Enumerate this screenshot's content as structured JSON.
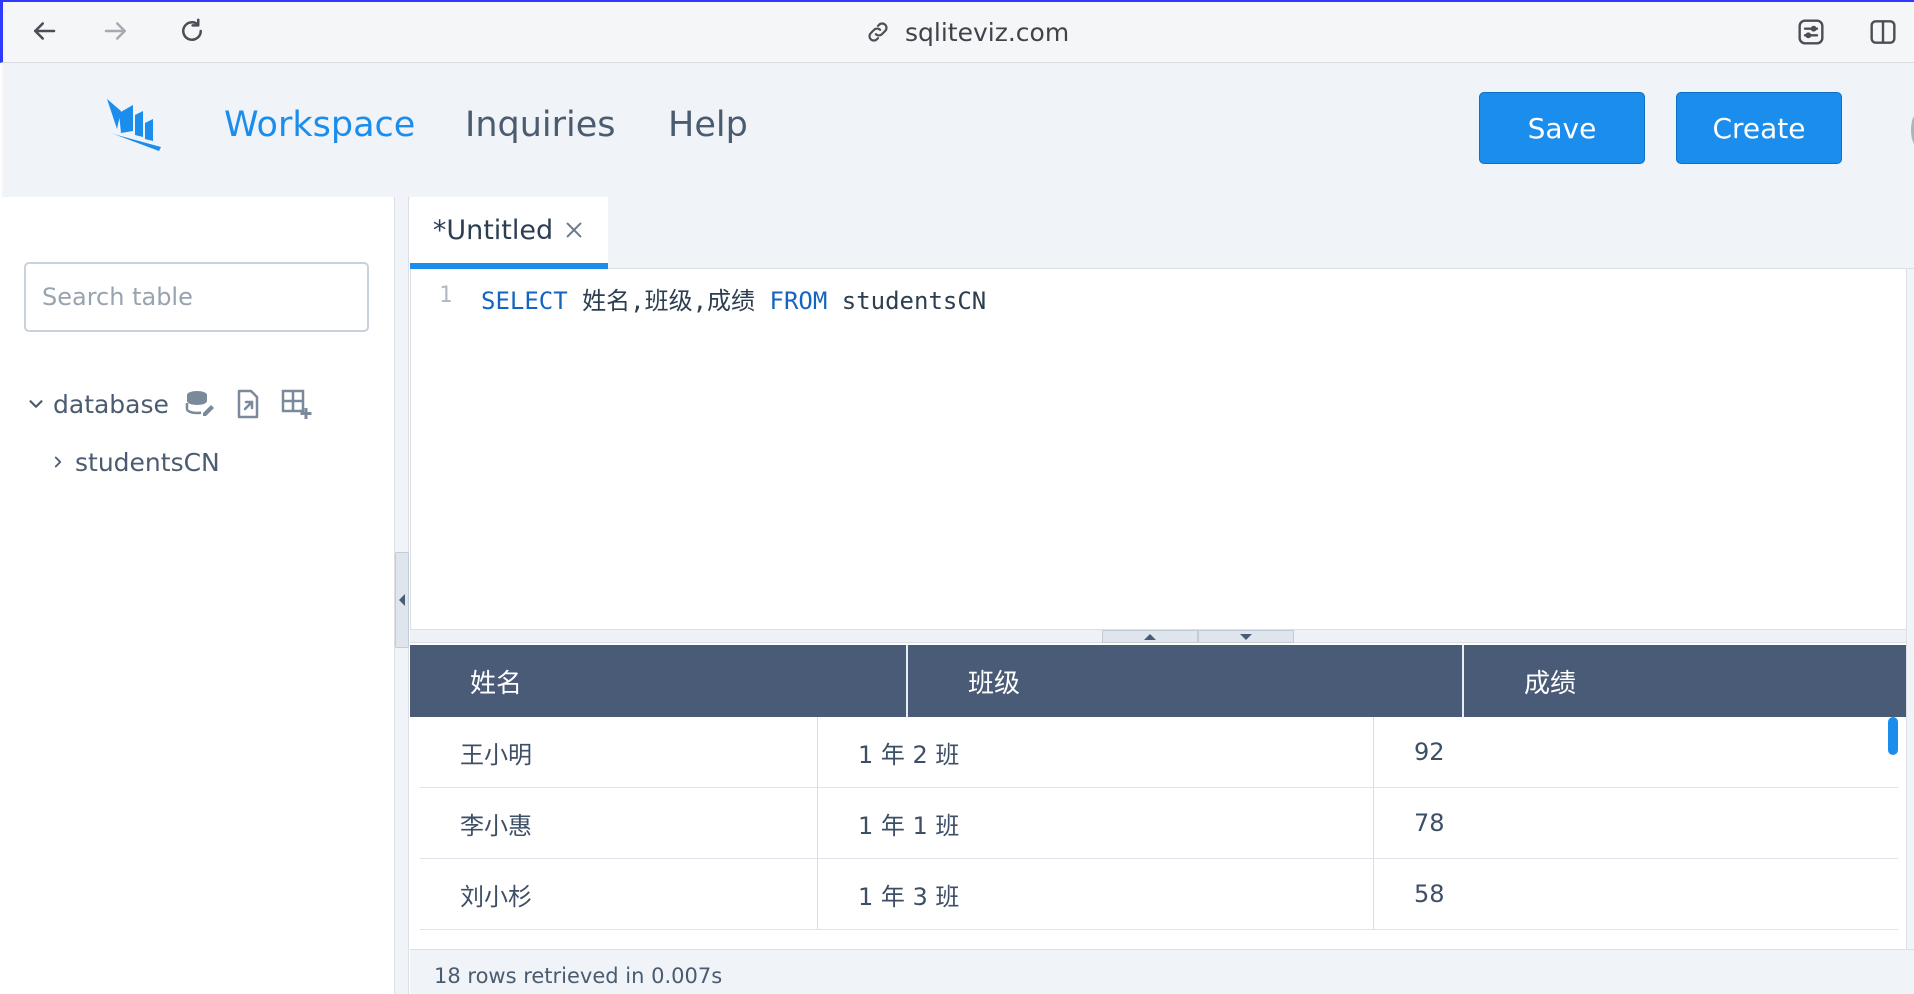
{
  "browser": {
    "url": "sqliteviz.com",
    "icons": [
      "back-arrow-icon",
      "forward-arrow-icon",
      "reload-icon",
      "link-icon",
      "page-settings-icon",
      "sidebar-toggle-icon"
    ]
  },
  "header": {
    "logo_icon": "sqliteviz-logo-icon",
    "nav": {
      "workspace": "Workspace",
      "inquiries": "Inquiries",
      "help": "Help"
    },
    "save_label": "Save",
    "create_label": "Create",
    "accent_color": "#1a8ded"
  },
  "sidebar": {
    "search_placeholder": "Search table",
    "database_label": "database",
    "db_icons": [
      "database-edit-icon",
      "import-file-icon",
      "add-table-icon"
    ],
    "tables": [
      {
        "name": "studentsCN"
      }
    ]
  },
  "editor": {
    "tab_title": "*Untitled",
    "line_number": "1",
    "code": {
      "kw_select": "SELECT",
      "columns": " 姓名,班级,成绩 ",
      "kw_from": "FROM",
      "table": " studentsCN"
    }
  },
  "results": {
    "columns": [
      "姓名",
      "班级",
      "成绩"
    ],
    "rows": [
      [
        "王小明",
        "1 年 2 班",
        "92"
      ],
      [
        "李小惠",
        "1 年 1 班",
        "78"
      ],
      [
        "刘小杉",
        "1 年 3 班",
        "58"
      ]
    ],
    "header_color": "#4a5b77",
    "status": "18 rows retrieved in 0.007s"
  }
}
